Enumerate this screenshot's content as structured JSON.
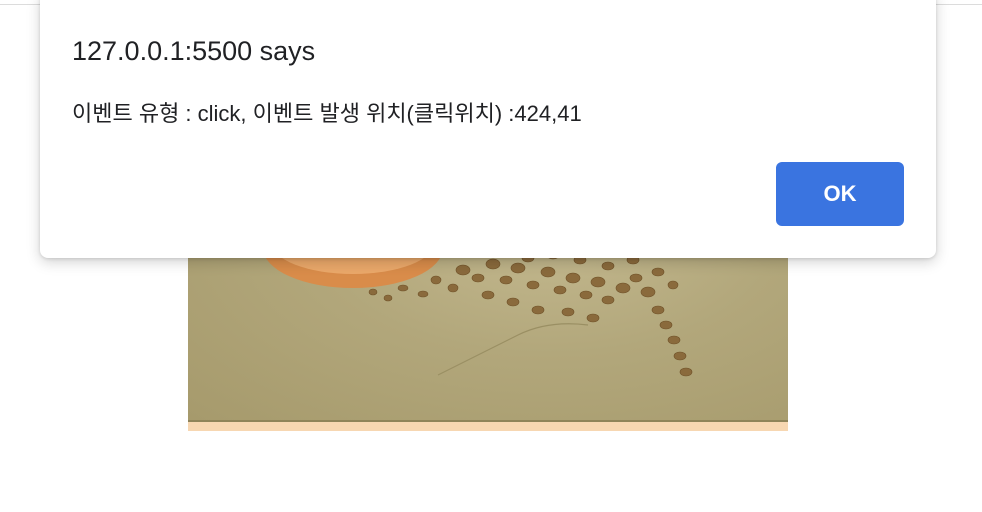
{
  "dialog": {
    "title": "127.0.0.1:5500 says",
    "message": "이벤트 유형 : click, 이벤트 발생 위치(클릭위치) :424,41",
    "ok_label": "OK",
    "button_color": "#3a74e0"
  },
  "background_image": {
    "subject": "coffee-cup-and-beans",
    "colors": {
      "surface": "#b2a77b",
      "beans": "#8a6a3c",
      "cup": "#e0a060",
      "strip": "#f7d7b2"
    }
  }
}
